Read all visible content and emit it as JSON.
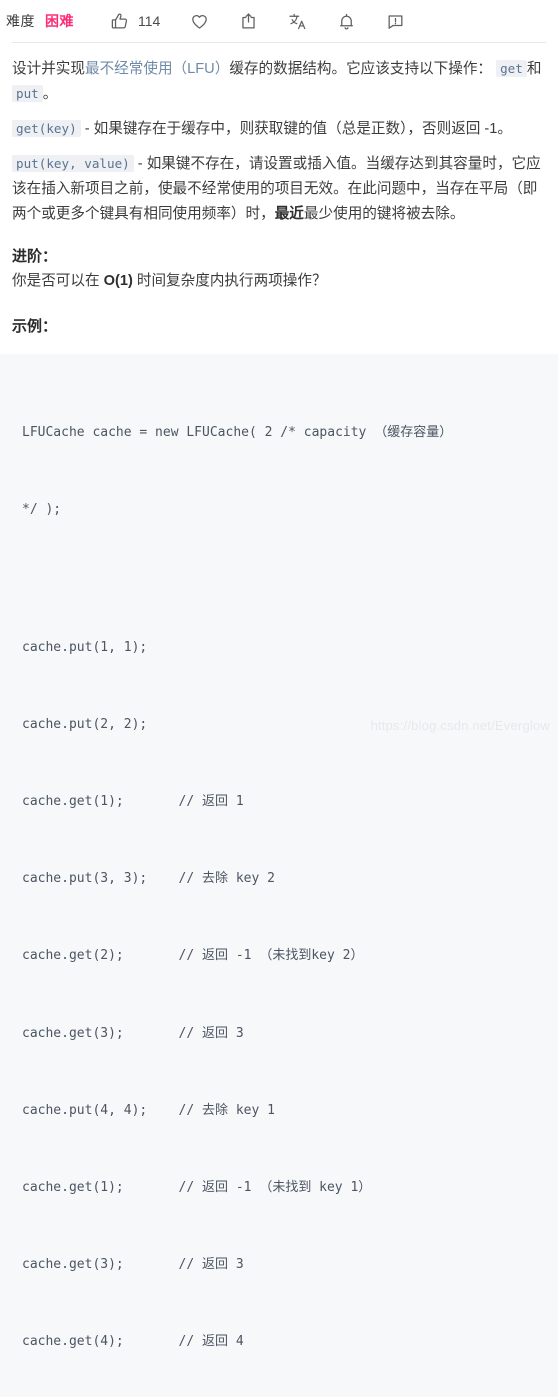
{
  "toolbar": {
    "difficulty_label": "难度",
    "difficulty_value": "困难",
    "difficulty_color": "#ff2d78",
    "like_count": "114",
    "items": [
      {
        "icon": "thumbs-up-icon",
        "name": "like-button",
        "label": "114"
      },
      {
        "icon": "heart-icon",
        "name": "favorite-button",
        "label": ""
      },
      {
        "icon": "share-icon",
        "name": "share-button",
        "label": ""
      },
      {
        "icon": "translate-icon",
        "name": "translate-button",
        "label": ""
      },
      {
        "icon": "bell-icon",
        "name": "notification-button",
        "label": ""
      },
      {
        "icon": "comment-icon",
        "name": "feedback-button",
        "label": ""
      }
    ]
  },
  "content": {
    "p1": {
      "before_link": "设计并实现",
      "link": "最不经常使用（LFU）",
      "after_link": "缓存的数据结构。它应该支持以下操作：",
      "code_get": "get",
      "mid": "和",
      "code_put": "put",
      "tail": "。"
    },
    "p2": {
      "code": "get(key)",
      "text": "- 如果键存在于缓存中，则获取键的值（总是正数），否则返回 -1。"
    },
    "p3": {
      "code": "put(key, value)",
      "text_a": "- 如果键不存在，请设置或插入值。当缓存达到其容量时，它应该在插入新项目之前，使最不经常使用的项目无效。在此问题中，当存在平局（即两个或更多个键具有相同使用频率）时，",
      "bold": "最近",
      "text_b": "最少使用的键将被去除。"
    },
    "advanced": {
      "heading": "进阶：",
      "text_a": "你是否可以在 ",
      "bold": "O(1)",
      "text_b": " 时间复杂度内执行两项操作？"
    },
    "example": {
      "heading": "示例：",
      "code_lines": [
        "LFUCache cache = new LFUCache( 2 /* capacity （缓存容量）",
        "*/ );",
        "",
        "cache.put(1, 1);",
        "cache.put(2, 2);",
        "cache.get(1);       // 返回 1",
        "cache.put(3, 3);    // 去除 key 2",
        "cache.get(2);       // 返回 -1 （未找到key 2）",
        "cache.get(3);       // 返回 3",
        "cache.put(4, 4);    // 去除 key 1",
        "cache.get(1);       // 返回 -1 （未找到 key 1）",
        "cache.get(3);       // 返回 3",
        "cache.get(4);       // 返回 4"
      ]
    }
  },
  "watermark": "https://blog.csdn.net/Everglow"
}
